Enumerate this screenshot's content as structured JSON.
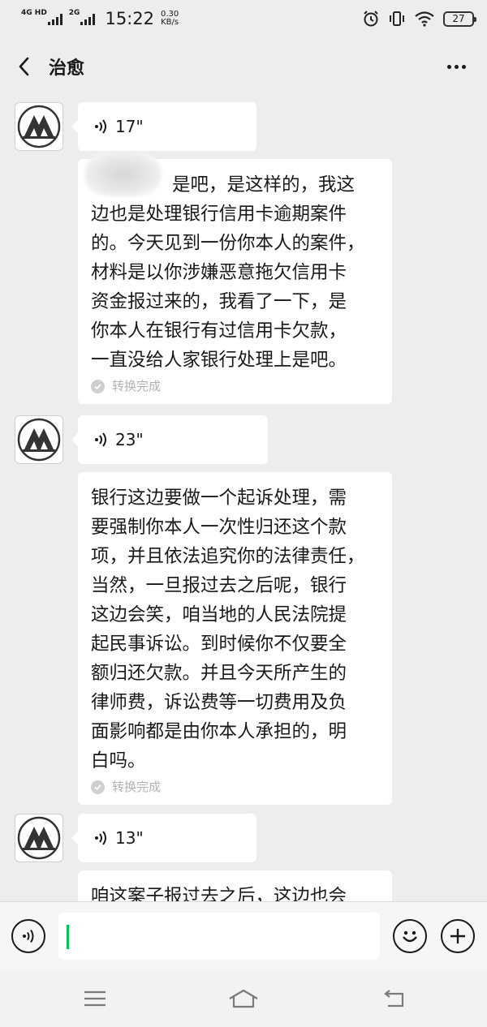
{
  "status_bar": {
    "sim1_label": "4G HD",
    "sim2_label": "2G",
    "time": "15:22",
    "net_speed_value": "0.30",
    "net_speed_unit": "KB/s",
    "battery": "27"
  },
  "header": {
    "title": "治愈"
  },
  "messages": [
    {
      "type": "voice",
      "duration": "17\""
    },
    {
      "type": "transcript",
      "lines": [
        "是吧，是这样的，我这",
        "边也是处理银行信用卡逾期案件",
        "的。今天见到一份你本人的案件，",
        "材料是以你涉嫌恶意拖欠信用卡",
        "资金报过来的，我看了一下，是",
        "你本人在银行有过信用卡欠款，",
        "一直没给人家银行处理上是吧。"
      ],
      "status": "转换完成"
    },
    {
      "type": "voice",
      "duration": "23\""
    },
    {
      "type": "transcript",
      "lines": [
        "银行这边要做一个起诉处理，需",
        "要强制你本人一次性归还这个款",
        "项，并且依法追究你的法律责任，",
        "当然，一旦报过去之后呢，银行",
        "这边会笑，咱当地的人民法院提",
        "起民事诉讼。到时候你不仅要全",
        "额归还欠款。并且今天所产生的",
        "律师费，诉讼费等一切费用及负",
        "面影响都是由你本人承担的，明",
        "白吗。"
      ],
      "status": "转换完成"
    },
    {
      "type": "voice",
      "duration": "13\""
    },
    {
      "type": "transcript_partial",
      "lines": [
        "咱这案子报过去之后，这边也会"
      ]
    }
  ],
  "input": {
    "value": ""
  },
  "icons": {
    "back": "chevron-left-icon",
    "more": "more-dots-icon",
    "voice_toggle": "voice-input-icon",
    "emoji": "emoji-icon",
    "plus": "plus-icon",
    "nav_menu": "menu-icon",
    "nav_home": "home-icon",
    "nav_back": "back-arrow-icon"
  },
  "colors": {
    "background": "#ededed",
    "bubble": "#ffffff",
    "caret": "#07c160",
    "muted_text": "#b2b2b2"
  }
}
